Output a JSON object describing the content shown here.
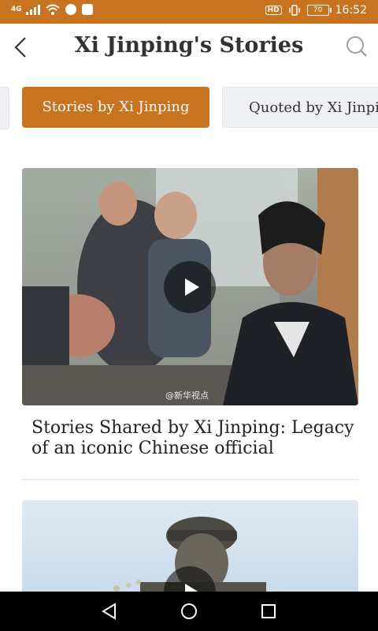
{
  "status_bar": {
    "network": "4G",
    "hd": "HD",
    "battery": "70",
    "time": "16:52"
  },
  "header": {
    "back_icon": "chevron-left-icon",
    "title": "Xi Jinping's Stories",
    "search_icon": "search-icon"
  },
  "tabs": [
    {
      "label": "",
      "active": false
    },
    {
      "label": "Stories by Xi Jinping",
      "active": true
    },
    {
      "label": "Quoted by Xi Jinping",
      "active": false
    }
  ],
  "articles": [
    {
      "title": "Stories Shared by Xi Jinping: Legacy of an iconic Chinese official",
      "watermark": "@新华视点",
      "has_video": true
    },
    {
      "title": "",
      "has_video": true
    }
  ],
  "colors": {
    "accent": "#c8731f",
    "tab_inactive": "#eef0f3",
    "text": "#222222"
  },
  "nav_bar": {
    "back": "triangle-back-icon",
    "home": "circle-home-icon",
    "recents": "square-recents-icon"
  }
}
